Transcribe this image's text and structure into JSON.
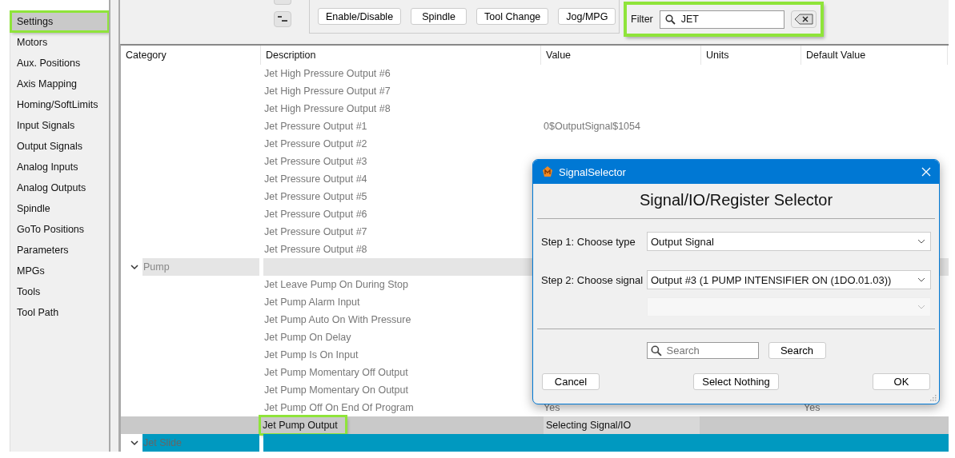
{
  "sidebar": {
    "items": [
      {
        "label": "Settings",
        "selected": true,
        "highlighted": true
      },
      {
        "label": "Motors",
        "selected": false,
        "highlighted": false
      },
      {
        "label": "Aux. Positions",
        "selected": false,
        "highlighted": false
      },
      {
        "label": "Axis Mapping",
        "selected": false,
        "highlighted": false
      },
      {
        "label": "Homing/SoftLimits",
        "selected": false,
        "highlighted": false
      },
      {
        "label": "Input Signals",
        "selected": false,
        "highlighted": false
      },
      {
        "label": "Output Signals",
        "selected": false,
        "highlighted": false
      },
      {
        "label": "Analog Inputs",
        "selected": false,
        "highlighted": false
      },
      {
        "label": "Analog Outputs",
        "selected": false,
        "highlighted": false
      },
      {
        "label": "Spindle",
        "selected": false,
        "highlighted": false
      },
      {
        "label": "GoTo Positions",
        "selected": false,
        "highlighted": false
      },
      {
        "label": "Parameters",
        "selected": false,
        "highlighted": false
      },
      {
        "label": "MPGs",
        "selected": false,
        "highlighted": false
      },
      {
        "label": "Tools",
        "selected": false,
        "highlighted": false
      },
      {
        "label": "Tool Path",
        "selected": false,
        "highlighted": false
      }
    ]
  },
  "toolbar": {
    "buttons": [
      "Enable/Disable",
      "Spindle",
      "Tool Change",
      "Jog/MPG"
    ]
  },
  "filter": {
    "label": "Filter",
    "value": "JET",
    "highlighted": true
  },
  "table": {
    "columns": [
      "Category",
      "Description",
      "Value",
      "Units",
      "Default Value"
    ],
    "rows": [
      {
        "kind": "item",
        "description": "Jet High Pressure Output #6",
        "selected": false,
        "highlighted": false
      },
      {
        "kind": "item",
        "description": "Jet High Pressure Output #7",
        "selected": false,
        "highlighted": false
      },
      {
        "kind": "item",
        "description": "Jet High Pressure Output #8",
        "selected": false,
        "highlighted": false
      },
      {
        "kind": "item",
        "description": "Jet Pressure Output #1",
        "value": "0$OutputSignal$1054",
        "selected": false,
        "highlighted": false
      },
      {
        "kind": "item",
        "description": "Jet Pressure Output #2",
        "selected": false,
        "highlighted": false
      },
      {
        "kind": "item",
        "description": "Jet Pressure Output #3",
        "selected": false,
        "highlighted": false
      },
      {
        "kind": "item",
        "description": "Jet Pressure Output #4",
        "selected": false,
        "highlighted": false
      },
      {
        "kind": "item",
        "description": "Jet Pressure Output #5",
        "selected": false,
        "highlighted": false
      },
      {
        "kind": "item",
        "description": "Jet Pressure Output #6",
        "selected": false,
        "highlighted": false
      },
      {
        "kind": "item",
        "description": "Jet Pressure Output #7",
        "selected": false,
        "highlighted": false
      },
      {
        "kind": "item",
        "description": "Jet Pressure Output #8",
        "selected": false,
        "highlighted": false
      },
      {
        "kind": "group",
        "label": "Pump",
        "expanded": true,
        "selected": false
      },
      {
        "kind": "item",
        "description": "Jet Leave Pump On During Stop",
        "selected": false,
        "highlighted": false
      },
      {
        "kind": "item",
        "description": "Jet Pump Alarm Input",
        "selected": false,
        "highlighted": false
      },
      {
        "kind": "item",
        "description": "Jet Pump Auto On With Pressure",
        "selected": false,
        "highlighted": false
      },
      {
        "kind": "item",
        "description": "Jet Pump On Delay",
        "selected": false,
        "highlighted": false
      },
      {
        "kind": "item",
        "description": "Jet Pump Is On Input",
        "selected": false,
        "highlighted": false
      },
      {
        "kind": "item",
        "description": "Jet Pump Momentary Off Output",
        "selected": false,
        "highlighted": false
      },
      {
        "kind": "item",
        "description": "Jet Pump Momentary On Output",
        "selected": false,
        "highlighted": false
      },
      {
        "kind": "item",
        "description": "Jet Pump Off On End Of Program",
        "value": "Yes",
        "default_value": "Yes",
        "selected": false,
        "highlighted": false
      },
      {
        "kind": "item",
        "description": "Jet Pump Output",
        "value": "Selecting Signal/IO",
        "selected": true,
        "highlighted": true
      },
      {
        "kind": "group",
        "label": "Jet Slide",
        "expanded": true,
        "selected": true
      }
    ]
  },
  "dialog": {
    "title": "SignalSelector",
    "heading": "Signal/IO/Register Selector",
    "step1": {
      "label": "Step 1: Choose type",
      "value": "Output Signal"
    },
    "step2": {
      "label": "Step 2: Choose signal",
      "value": "Output #3 (1 PUMP INTENSIFIER ON (1DO.01.03))"
    },
    "step3": {
      "disabled": true
    },
    "search": {
      "placeholder": "Search",
      "button": "Search"
    },
    "buttons": [
      "Cancel",
      "Select Nothing",
      "OK"
    ]
  }
}
